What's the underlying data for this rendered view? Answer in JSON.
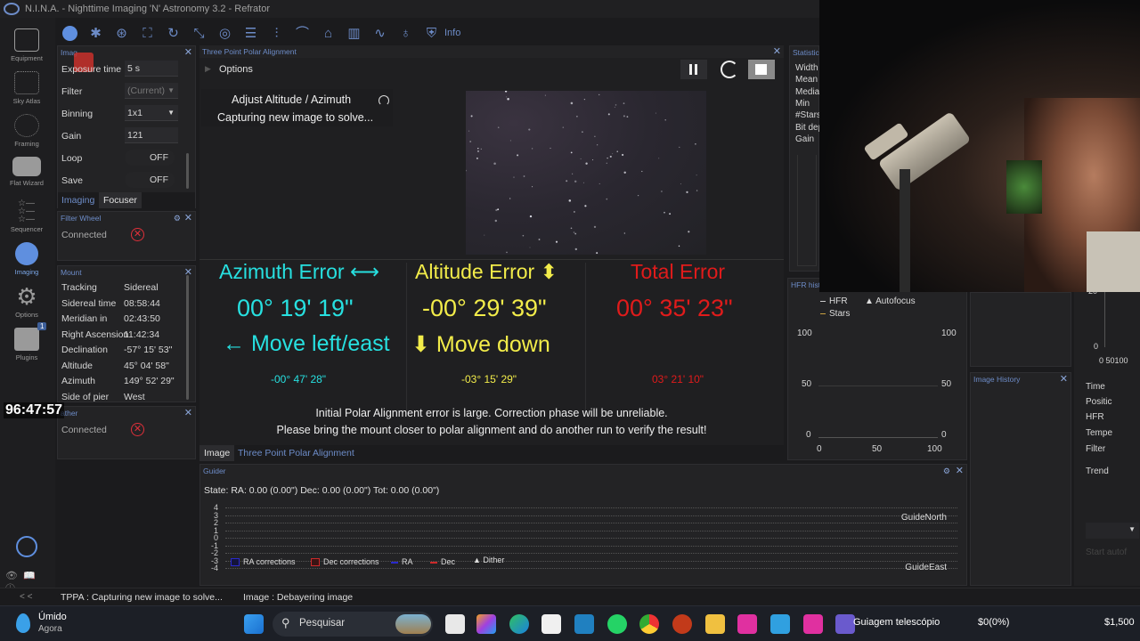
{
  "window": {
    "title": "N.I.N.A. - Nighttime Imaging 'N' Astronomy 3.2 - Refrator"
  },
  "nav": [
    {
      "label": "Equipment",
      "icon": "camera-icon"
    },
    {
      "label": "Sky Atlas",
      "icon": "sky-atlas-icon"
    },
    {
      "label": "Framing",
      "icon": "framing-icon"
    },
    {
      "label": "Flat Wizard",
      "icon": "flat-wizard-icon"
    },
    {
      "label": "Sequencer",
      "icon": "sequencer-icon"
    },
    {
      "label": "Imaging",
      "icon": "imaging-icon"
    },
    {
      "label": "Options",
      "icon": "gear-icon"
    },
    {
      "label": "Plugins",
      "icon": "puzzle-icon",
      "badge": "1"
    }
  ],
  "toolbar": {
    "info_label": "Info"
  },
  "imaging_panel": {
    "title": "Imag",
    "rows": [
      {
        "label": "Exposure time",
        "value": "5",
        "unit": "s"
      },
      {
        "label": "Filter",
        "value": "(Current)"
      },
      {
        "label": "Binning",
        "value": "1x1"
      },
      {
        "label": "Gain",
        "value": "121"
      },
      {
        "label": "Loop",
        "value": "OFF"
      },
      {
        "label": "Save",
        "value": "OFF"
      }
    ],
    "tabs": [
      "Imaging",
      "Focuser"
    ]
  },
  "filter_wheel": {
    "title": "Filter Wheel",
    "status": "Connected"
  },
  "mount": {
    "title": "Mount",
    "rows": [
      {
        "label": "Tracking",
        "value": "Sidereal"
      },
      {
        "label": "Sidereal time",
        "value": "08:58:44"
      },
      {
        "label": "Meridian in",
        "value": "02:43:50"
      },
      {
        "label": "Right Ascension",
        "value": "11:42:34"
      },
      {
        "label": "Declination",
        "value": "-57° 15' 53\""
      },
      {
        "label": "Altitude",
        "value": "45° 04' 58\""
      },
      {
        "label": "Azimuth",
        "value": "149° 52' 29\""
      },
      {
        "label": "Side of pier",
        "value": "West"
      }
    ]
  },
  "weather": {
    "title": "ather",
    "status": "Connected"
  },
  "overlay_clock": "96:47:57",
  "tppa": {
    "title": "Three Point Polar Alignment",
    "options_label": "Options",
    "step_title": "Adjust Altitude / Azimuth",
    "step_status": "Capturing new image to solve...",
    "azimuth": {
      "title": "Azimuth Error ⟷",
      "value": "00° 19' 19\"",
      "move": "← Move left/east",
      "total": "-00° 47' 28\""
    },
    "altitude": {
      "title": "Altitude Error ⬍",
      "value": "-00° 29' 39\"",
      "move": "⬇ Move down",
      "total": "-03° 15' 29\""
    },
    "total": {
      "title": "Total Error",
      "value": "00° 35' 23\"",
      "total": "03° 21' 10\""
    },
    "warning_line1": "Initial Polar Alignment error is large. Correction phase will be unreliable.",
    "warning_line2": "Please bring the mount closer to polar alignment and do another run to verify the result!",
    "tabs": [
      "Image",
      "Three Point Polar Alignment"
    ]
  },
  "statistics": {
    "title": "Statistics",
    "labels": [
      "Width",
      "Mean",
      "Media",
      "Min",
      "#Stars",
      "Bit dep",
      "Gain"
    ]
  },
  "hfr_history": {
    "title": "HFR histo",
    "legend": [
      "HFR",
      "Autofocus",
      "Stars"
    ],
    "y_ticks": [
      "100",
      "50",
      "0"
    ],
    "x_ticks": [
      "0",
      "50",
      "100"
    ]
  },
  "right_col": {
    "image_history_title": "Image History",
    "labels": [
      "Time",
      "Positic",
      "HFR",
      "Tempe",
      "Filter",
      "Trend"
    ],
    "y_ticks": [
      "20",
      "0"
    ],
    "x_ticks": "0 50100",
    "start_label": "Start autof"
  },
  "guider": {
    "title": "Guider",
    "state": "State:  RA: 0.00 (0.00\")  Dec: 0.00 (0.00\")  Tot: 0.00 (0.00\")",
    "y_ticks": [
      "4",
      "3",
      "2",
      "1",
      "0",
      "-1",
      "-2",
      "-3",
      "-4"
    ],
    "north": "GuideNorth",
    "east": "GuideEast",
    "legend": [
      "RA corrections",
      "Dec corrections",
      "RA",
      "Dec",
      "Dither"
    ],
    "colors": {
      "ra_corr": "#1a1a8a",
      "dec_corr": "#a01a1a",
      "ra": "#2a2acc",
      "dec": "#cc2a2a"
    }
  },
  "statusbar": {
    "collapse": "< <",
    "tppa": "TPPA :   Capturing new image to solve...",
    "image": "Image :   Debayering image"
  },
  "taskbar": {
    "weather": "Úmido",
    "weather_sub": "Agora",
    "search": "Pesquisar",
    "app_title": "Guiagem telescópio",
    "amount": "$0(0%)",
    "price": "$1,500"
  }
}
